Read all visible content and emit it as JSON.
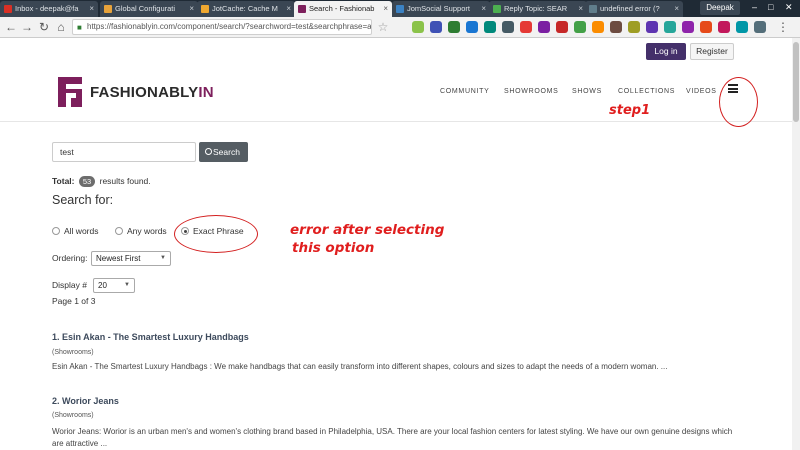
{
  "browser": {
    "tabs": [
      {
        "title": "Inbox - deepak@fa",
        "fav_color": "#d93025"
      },
      {
        "title": "Global Configurati",
        "fav_color": "#e8a33b"
      },
      {
        "title": "JotCache: Cache M",
        "fav_color": "#f0a830"
      },
      {
        "title": "Search - Fashionab",
        "fav_color": "#7d1f5c",
        "active": true
      },
      {
        "title": "JomSocial Support",
        "fav_color": "#3b82c4"
      },
      {
        "title": "Reply Topic: SEAR",
        "fav_color": "#4caf50"
      },
      {
        "title": "undefined error (?",
        "fav_color": "#607d8b"
      }
    ],
    "user": "Deepak",
    "url": "https://fashionablyin.com/component/search/?searchword=test&searchphrase=all&"
  },
  "header": {
    "login_label": "Log in",
    "register_label": "Register",
    "logo_text_main": "FASHIONABLY",
    "logo_text_accent": "IN",
    "nav": [
      "COMMUNITY",
      "SHOWROOMS",
      "SHOWS",
      "COLLECTIONS",
      "VIDEOS"
    ]
  },
  "annotations": {
    "step1": "step1",
    "error_line1": "error after selecting",
    "error_line2": "this option",
    "color": "#e01e1e"
  },
  "search": {
    "query": "test",
    "button_label": "Search",
    "total_label": "Total:",
    "total_count": "53",
    "total_suffix": "results found.",
    "search_for_heading": "Search for:",
    "options": [
      {
        "label": "All words",
        "selected": false
      },
      {
        "label": "Any words",
        "selected": false
      },
      {
        "label": "Exact Phrase",
        "selected": true
      }
    ],
    "ordering_label": "Ordering:",
    "ordering_value": "Newest First",
    "display_label": "Display #",
    "display_value": "20",
    "page_info": "Page 1 of 3"
  },
  "results": [
    {
      "title": "1. Esin Akan - The Smartest Luxury Handbags",
      "category": "(Showrooms)",
      "description": "Esin Akan - The Smartest Luxury Handbags : We make handbags that can easily transform into different shapes, colours and sizes to adapt the needs of a modern woman.    ..."
    },
    {
      "title": "2. Worior Jeans",
      "category": "(Showrooms)",
      "description": "Worior Jeans: Worior is an urban men's and women's clothing brand based in Philadelphia, USA. There are your local fashion centers for latest styling. We have our own genuine designs which are attractive ..."
    }
  ],
  "colors": {
    "brand_purple": "#44306a",
    "logo_magenta": "#7d1f5c",
    "search_button": "#555d63"
  }
}
